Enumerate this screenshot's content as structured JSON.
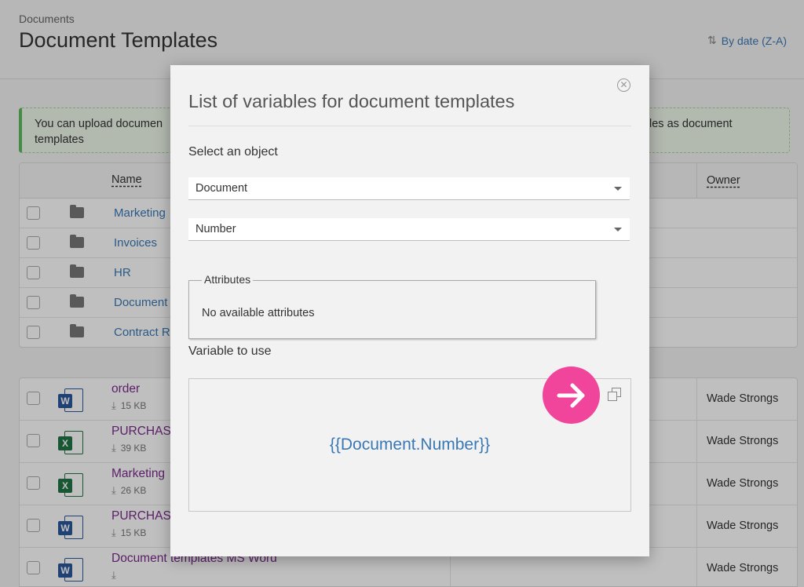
{
  "header": {
    "breadcrumb": "Documents",
    "title": "Document Templates",
    "sort_label": "By date (Z-A)"
  },
  "banner": {
    "text_left": "You can upload documen",
    "text_left_2": "templates",
    "text_right": "les as document"
  },
  "folder_table": {
    "col_name": "Name",
    "col_owner": "Owner",
    "rows": [
      {
        "name": "Marketing"
      },
      {
        "name": "Invoices"
      },
      {
        "name": "HR"
      },
      {
        "name": "Document"
      },
      {
        "name": "Contract R"
      }
    ]
  },
  "file_table": {
    "rows": [
      {
        "name": "order",
        "size": "15 KB",
        "owner": "Wade Strongs",
        "type": "word"
      },
      {
        "name": "PURCHASI",
        "size": "39 KB",
        "owner": "Wade Strongs",
        "type": "excel"
      },
      {
        "name": "Marketing",
        "size": "26 KB",
        "owner": "Wade Strongs",
        "type": "excel"
      },
      {
        "name": "PURCHASI",
        "size": "15 KB",
        "owner": "Wade Strongs",
        "type": "word"
      },
      {
        "name": "Document templates MS Word",
        "size": "",
        "owner": "Wade Strongs",
        "type": "word"
      }
    ]
  },
  "modal": {
    "title": "List of variables for document templates",
    "select_label": "Select an object",
    "object_value": "Document",
    "field_value": "Number",
    "attributes_legend": "Attributes",
    "attributes_empty": "No available attributes",
    "variable_label": "Variable to use",
    "variable_value": "{{Document.Number}}"
  },
  "icons": {
    "close": "close-circle-icon",
    "copy": "copy-icon",
    "pointer": "arrow-right-icon"
  },
  "colors": {
    "link": "#3a78b5",
    "file_link": "#7b2a8c",
    "pointer_badge": "#f0459a",
    "banner_accent": "#5cb85c"
  }
}
